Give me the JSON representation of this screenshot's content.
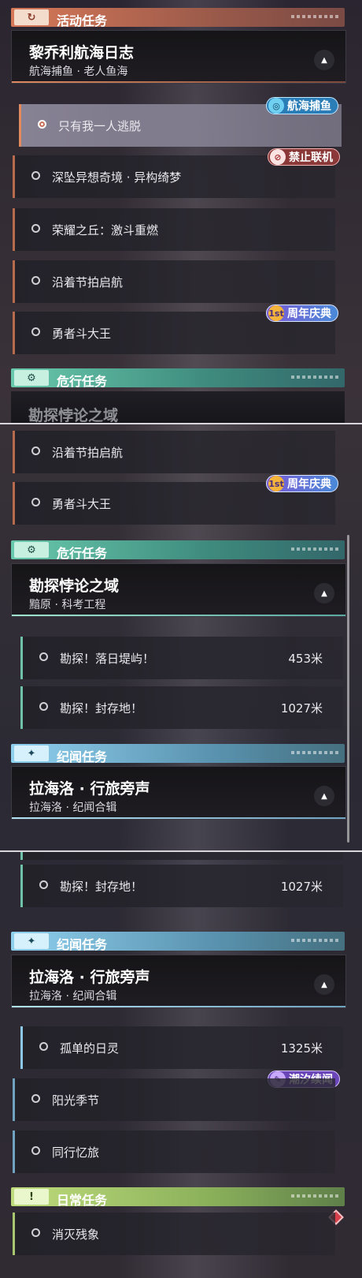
{
  "panel1": {
    "section_activity": {
      "title": "活动任务",
      "icon": "refresh-icon"
    },
    "activity_card": {
      "title": "黎乔利航海日志",
      "subtitle": "航海捕鱼 · 老人鱼海"
    },
    "activity_rows": [
      {
        "label": "只有我一人逃脱",
        "selected": true
      },
      {
        "label": "深坠异想奇境 · 异构绮梦",
        "selected": false
      },
      {
        "label": "荣耀之丘：激斗重燃",
        "selected": false
      },
      {
        "label": "沿着节拍启航",
        "selected": false
      },
      {
        "label": "勇者斗大王",
        "selected": false
      }
    ],
    "badges": {
      "fishing": "航海捕鱼",
      "no_online": "禁止联机",
      "anniversary": "周年庆典",
      "anniversary_icon": "1st"
    },
    "section_danger": {
      "title": "危行任务",
      "icon": "gear-icon"
    },
    "danger_peek": "勘探悖论之域"
  },
  "panel2": {
    "rows_top": [
      {
        "label": "沿着节拍启航"
      },
      {
        "label": "勇者斗大王"
      }
    ],
    "badges": {
      "anniversary": "周年庆典",
      "anniversary_icon": "1st"
    },
    "section_danger": {
      "title": "危行任务",
      "icon": "gear-icon"
    },
    "danger_card": {
      "title": "勘探悖论之域",
      "subtitle": "黯原 · 科考工程"
    },
    "danger_rows": [
      {
        "label": "勘探！落日堤屿！",
        "distance": "453米"
      },
      {
        "label": "勘探！封存地！",
        "distance": "1027米"
      }
    ],
    "section_lore": {
      "title": "纪闻任务",
      "icon": "sparkle-icon"
    },
    "lore_card": {
      "title": "拉海洛 · 行旅旁声",
      "subtitle": "拉海洛 · 纪闻合辑"
    }
  },
  "panel3": {
    "danger_rows": [
      {
        "label": "勘探！封存地！",
        "distance": "1027米"
      }
    ],
    "section_lore": {
      "title": "纪闻任务",
      "icon": "sparkle-icon"
    },
    "lore_card": {
      "title": "拉海洛 · 行旅旁声",
      "subtitle": "拉海洛 · 纪闻合辑"
    },
    "lore_rows": [
      {
        "label": "孤单的日灵",
        "distance": "1325米"
      },
      {
        "label": "阳光季节",
        "distance": ""
      },
      {
        "label": "同行忆旅",
        "distance": ""
      }
    ],
    "badges": {
      "tide": "潮汐续闻"
    },
    "section_daily": {
      "title": "日常任务",
      "icon": "exclamation-icon"
    },
    "daily_rows": [
      {
        "label": "消灭残象"
      }
    ]
  },
  "colors": {
    "activity": "#d77858",
    "danger": "#68c9ac",
    "lore": "#8fd0ee",
    "daily": "#bfdc7c",
    "selected_accent": "#c86e52"
  }
}
